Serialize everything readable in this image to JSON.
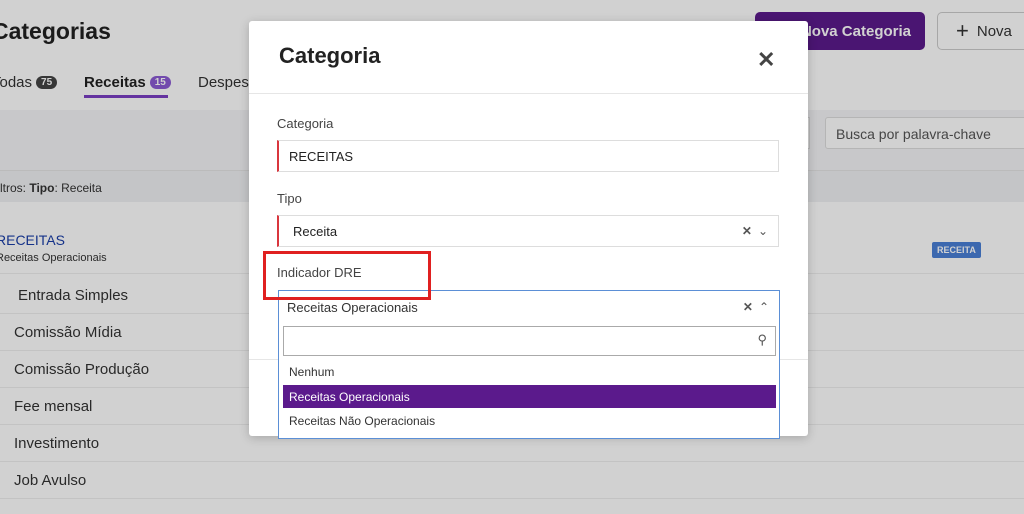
{
  "page": {
    "title": "Categorias",
    "new_category_button": "Nova Categoria",
    "new_button": "Nova",
    "tabs": [
      {
        "label": "Todas",
        "count": "75"
      },
      {
        "label": "Receitas",
        "count": "15"
      },
      {
        "label": "Despesas",
        "count": ""
      }
    ],
    "search_placeholder": "Busca por palavra-chave",
    "filters_prefix": "Filtros:",
    "filter_key": "Tipo",
    "filter_value": ": Receita",
    "group": {
      "title": "RECEITAS",
      "subtitle": "Receitas Operacionais",
      "tag": "RECEITA"
    },
    "rows": [
      "Entrada Simples",
      "Comissão Mídia",
      "Comissão Produção",
      "Fee mensal",
      "Investimento",
      "Job Avulso"
    ]
  },
  "modal": {
    "title": "Categoria",
    "close_icon": "close-icon",
    "fields": {
      "categoria": {
        "label": "Categoria",
        "value": "RECEITAS"
      },
      "tipo": {
        "label": "Tipo",
        "value": "Receita"
      },
      "indicador": {
        "label": "Indicador DRE",
        "value": "Receitas Operacionais"
      }
    },
    "dropdown": {
      "options": [
        "Nenhum",
        "Receitas Operacionais",
        "Receitas Não Operacionais"
      ],
      "selected": "Receitas Operacionais"
    }
  },
  "colors": {
    "brand": "#5b1a8c",
    "accent": "#7b3fc4",
    "error": "#d9363e",
    "highlight": "#e02020",
    "focus": "#5b8fd6"
  }
}
